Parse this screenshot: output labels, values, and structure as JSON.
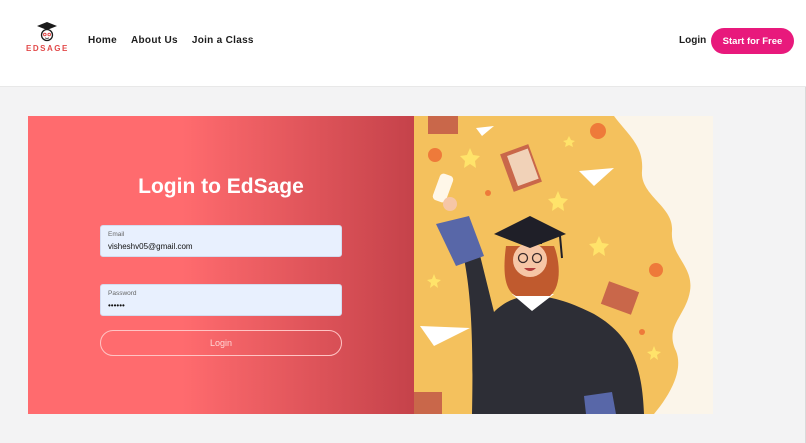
{
  "brand": {
    "name": "EDSAGE"
  },
  "nav": {
    "items": [
      {
        "label": "Home"
      },
      {
        "label": "About Us"
      },
      {
        "label": "Join a Class"
      }
    ],
    "login_label": "Login",
    "cta_label": "Start for Free"
  },
  "login_form": {
    "title": "Login to EdSage",
    "email_label": "Email",
    "email_value": "visheshv05@gmail.com",
    "password_label": "Password",
    "password_value": "••••••",
    "submit_label": "Login"
  },
  "colors": {
    "accent": "#e8197c",
    "panel_left": "#ff6b6e",
    "panel_right": "#c5424a",
    "illustration_bg": "#f4c15d"
  },
  "icons": {
    "logo": "graduation-cap-icon",
    "illustration": "graduate-illustration"
  }
}
